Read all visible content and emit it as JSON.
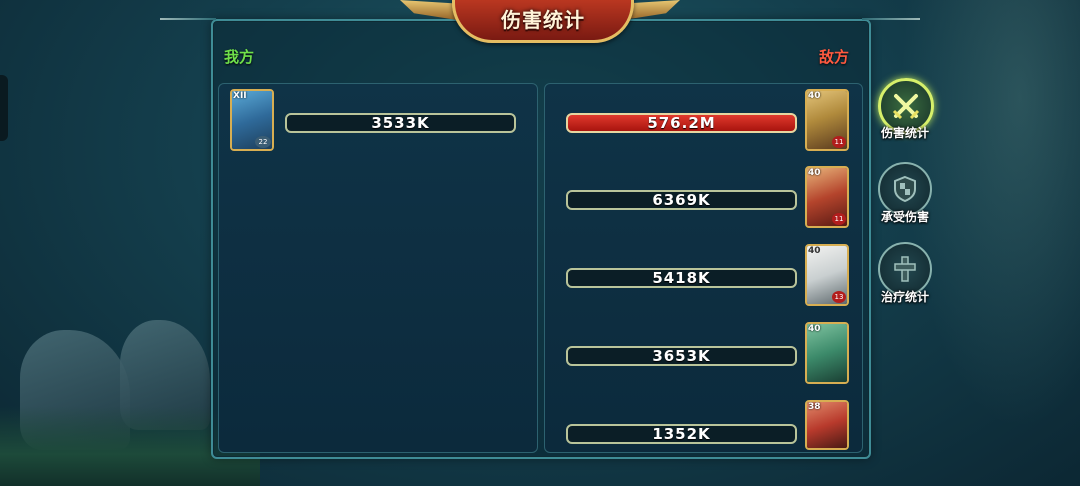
{
  "header": {
    "title": "伤害统计"
  },
  "sides": {
    "ally": "我方",
    "enemy": "敌方"
  },
  "ally_units": [
    {
      "level": "XII",
      "stars": "22",
      "damage": "3533K",
      "portrait_icon": "archer-hero-portrait"
    }
  ],
  "enemy_units": [
    {
      "level": "40",
      "stars": "11",
      "damage": "576.2M",
      "top": true,
      "portrait_icon": "golden-knight-portrait"
    },
    {
      "level": "40",
      "stars": "11",
      "damage": "6369K",
      "portrait_icon": "red-warrior-portrait"
    },
    {
      "level": "40",
      "stars": "13",
      "damage": "5418K",
      "portrait_icon": "panda-monk-portrait"
    },
    {
      "level": "40",
      "stars": "",
      "damage": "3653K",
      "portrait_icon": "green-ogre-portrait"
    },
    {
      "level": "38",
      "stars": "",
      "damage": "1352K",
      "portrait_icon": "red-captain-portrait"
    }
  ],
  "side_tabs": [
    {
      "label": "伤害统计",
      "icon": "crossed-swords-icon",
      "active": true
    },
    {
      "label": "承受伤害",
      "icon": "shield-icon",
      "active": false
    },
    {
      "label": "治疗统计",
      "icon": "healing-cross-icon",
      "active": false
    }
  ],
  "colors": {
    "top_bar": "#c8241b",
    "ally_label": "#6fe04a",
    "enemy_label": "#ff5a40",
    "active_tab_ring": "#d6f06a"
  }
}
